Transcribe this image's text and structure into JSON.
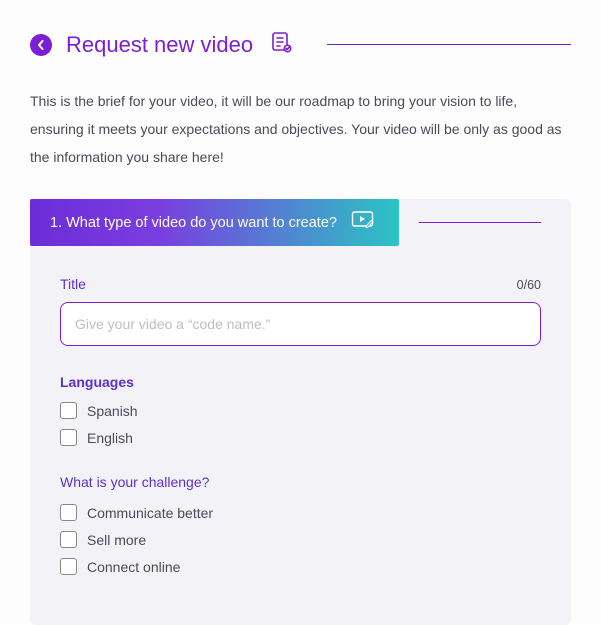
{
  "header": {
    "title": "Request new video"
  },
  "intro": "This is the brief for your video, it will be our roadmap to bring your vision to life, ensuring it meets your expectations and objectives. Your video will be only as good as the information you share here!",
  "section": {
    "number": "1.",
    "question": "What type of video do you want to create?"
  },
  "titleField": {
    "label": "Title",
    "counter": "0/60",
    "placeholder": "Give your video a “code name.”",
    "value": ""
  },
  "languages": {
    "label": "Languages",
    "options": [
      {
        "label": "Spanish"
      },
      {
        "label": "English"
      }
    ]
  },
  "challenge": {
    "label": "What is your challenge?",
    "options": [
      {
        "label": "Communicate better"
      },
      {
        "label": "Sell more"
      },
      {
        "label": "Connect online"
      }
    ]
  }
}
